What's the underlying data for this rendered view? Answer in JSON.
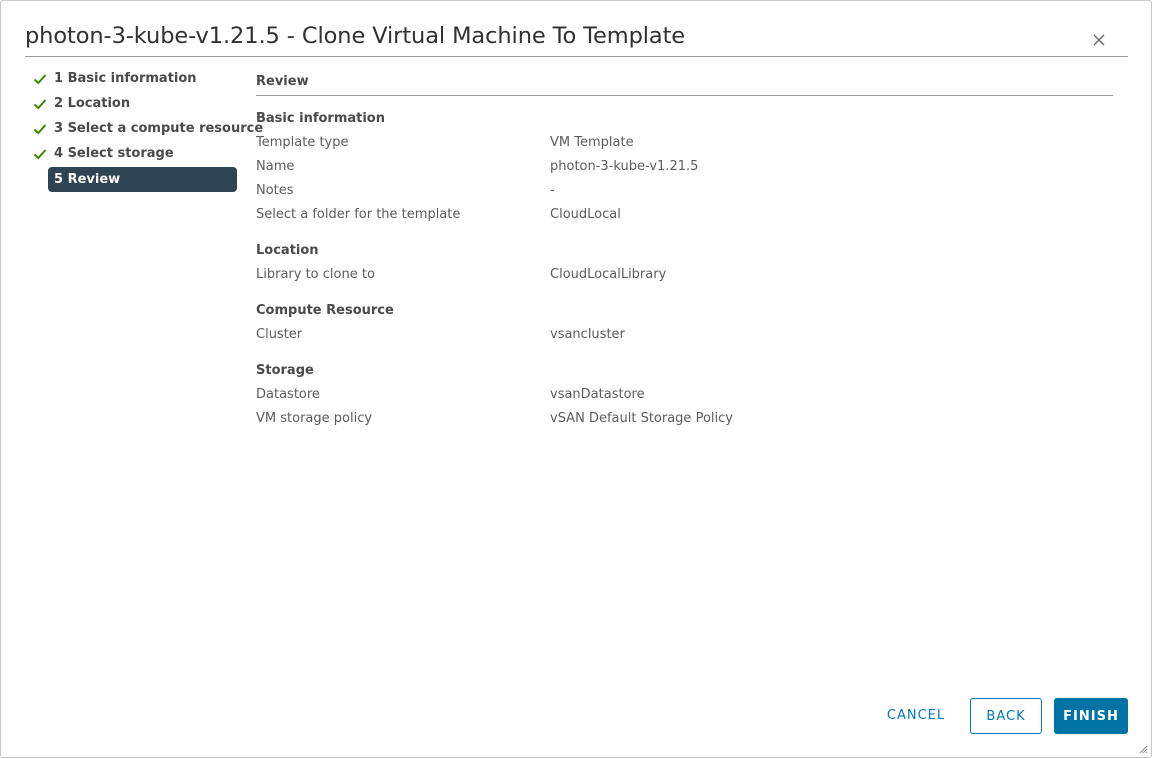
{
  "dialog": {
    "title": "photon-3-kube-v1.21.5 - Clone Virtual Machine To Template",
    "close_icon": "close-icon"
  },
  "steps": [
    {
      "label": "1 Basic information",
      "state": "done"
    },
    {
      "label": "2 Location",
      "state": "done"
    },
    {
      "label": "3 Select a compute resource",
      "state": "done"
    },
    {
      "label": "4 Select storage",
      "state": "done"
    },
    {
      "label": "5 Review",
      "state": "active"
    }
  ],
  "review": {
    "title": "Review",
    "sections": {
      "basic": {
        "title": "Basic information",
        "template_type": {
          "label": "Template type",
          "value": "VM Template"
        },
        "name": {
          "label": "Name",
          "value": "photon-3-kube-v1.21.5"
        },
        "notes": {
          "label": "Notes",
          "value": "-"
        },
        "folder": {
          "label": "Select a folder for the template",
          "value": "CloudLocal"
        }
      },
      "location": {
        "title": "Location",
        "library": {
          "label": "Library to clone to",
          "value": "CloudLocalLibrary"
        }
      },
      "compute": {
        "title": "Compute Resource",
        "cluster": {
          "label": "Cluster",
          "value": "vsancluster"
        }
      },
      "storage": {
        "title": "Storage",
        "datastore": {
          "label": "Datastore",
          "value": "vsanDatastore"
        },
        "policy": {
          "label": "VM storage policy",
          "value": "vSAN Default Storage Policy"
        }
      }
    }
  },
  "footer": {
    "cancel_label": "CANCEL",
    "back_label": "BACK",
    "finish_label": "FINISH"
  },
  "colors": {
    "check": "#3c8500",
    "active_step_bg": "#2e4453",
    "primary": "#0072a3",
    "link": "#0079b8"
  }
}
